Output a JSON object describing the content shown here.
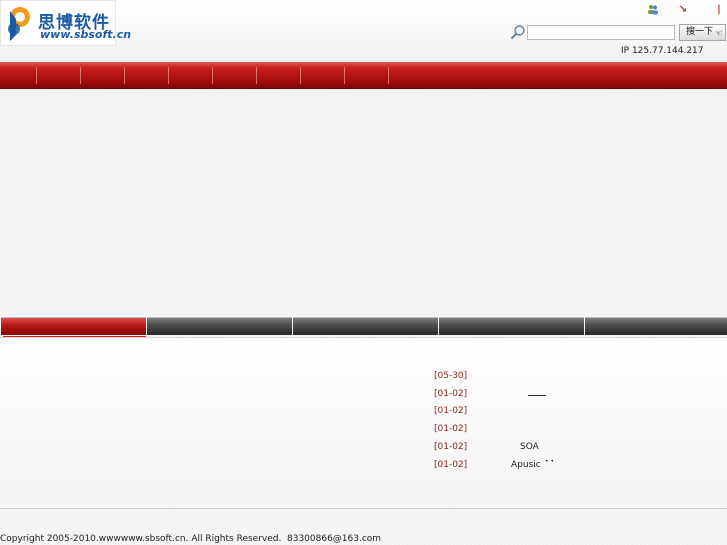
{
  "header": {
    "logo_cn": "思博软件",
    "logo_url": "www.sbsoft.cn",
    "icons": [
      "users-icon",
      "arrow-icon",
      "bar-icon"
    ],
    "search": {
      "placeholder": "",
      "button_label": "搜一下"
    },
    "ip_text": "IP 125.77.144.217"
  },
  "nav": {
    "item_count": 9
  },
  "tabs": [
    {
      "label": "",
      "active": true
    },
    {
      "label": "",
      "active": false
    },
    {
      "label": "",
      "active": false
    },
    {
      "label": "",
      "active": false
    },
    {
      "label": "",
      "active": false
    }
  ],
  "news": [
    {
      "date": "[05-30]",
      "title": ""
    },
    {
      "date": "[01-02]",
      "title": ""
    },
    {
      "date": "[01-02]",
      "title": ""
    },
    {
      "date": "[01-02]",
      "title": ""
    },
    {
      "date": "[01-02]",
      "title": "SOA"
    },
    {
      "date": "[01-02]",
      "title": "Apusic"
    }
  ],
  "footer": {
    "copyright": "Copyright 2005-2010.wwwwww.sbsoft.cn. All Rights Reserved.",
    "email": "83300866@163.com"
  },
  "colors": {
    "brand_blue": "#1b5aa6",
    "nav_red": "#b41714",
    "date_red": "#8a1e14"
  }
}
